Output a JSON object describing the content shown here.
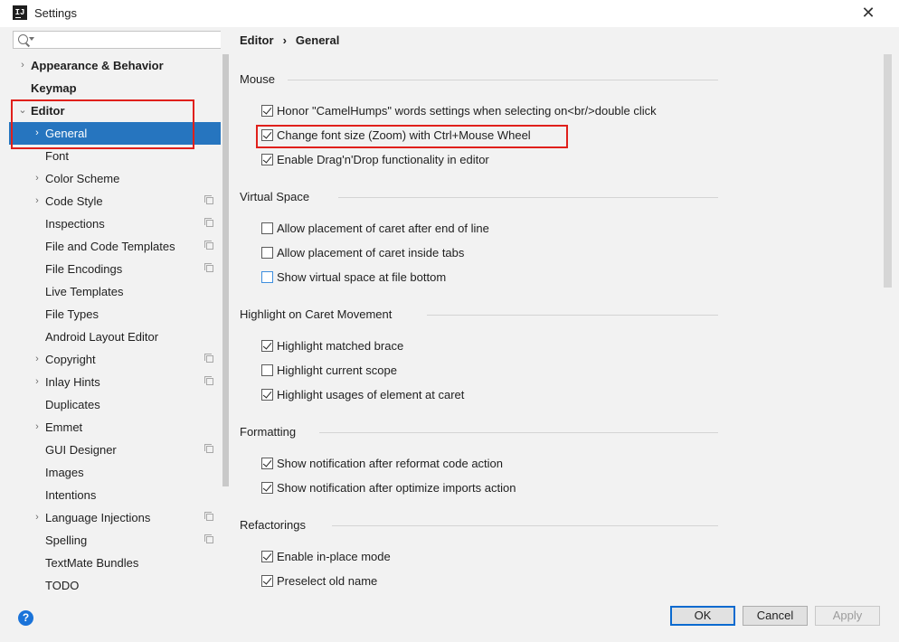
{
  "window": {
    "title": "Settings",
    "close_label": "✕"
  },
  "search": {
    "placeholder": ""
  },
  "sidebar": {
    "items": [
      {
        "label": "Appearance & Behavior",
        "bold": true,
        "chevron": "›",
        "indent": 0
      },
      {
        "label": "Keymap",
        "bold": true,
        "chevron": "",
        "indent": 0
      },
      {
        "label": "Editor",
        "bold": true,
        "chevron": "⌄",
        "indent": 0
      },
      {
        "label": "General",
        "bold": false,
        "chevron": "›",
        "indent": 1,
        "selected": true
      },
      {
        "label": "Font",
        "bold": false,
        "chevron": "",
        "indent": 1
      },
      {
        "label": "Color Scheme",
        "bold": false,
        "chevron": "›",
        "indent": 1
      },
      {
        "label": "Code Style",
        "bold": false,
        "chevron": "›",
        "indent": 1,
        "project_icon": true
      },
      {
        "label": "Inspections",
        "bold": false,
        "chevron": "",
        "indent": 1,
        "project_icon": true
      },
      {
        "label": "File and Code Templates",
        "bold": false,
        "chevron": "",
        "indent": 1,
        "project_icon": true
      },
      {
        "label": "File Encodings",
        "bold": false,
        "chevron": "",
        "indent": 1,
        "project_icon": true
      },
      {
        "label": "Live Templates",
        "bold": false,
        "chevron": "",
        "indent": 1
      },
      {
        "label": "File Types",
        "bold": false,
        "chevron": "",
        "indent": 1
      },
      {
        "label": "Android Layout Editor",
        "bold": false,
        "chevron": "",
        "indent": 1
      },
      {
        "label": "Copyright",
        "bold": false,
        "chevron": "›",
        "indent": 1,
        "project_icon": true
      },
      {
        "label": "Inlay Hints",
        "bold": false,
        "chevron": "›",
        "indent": 1,
        "project_icon": true
      },
      {
        "label": "Duplicates",
        "bold": false,
        "chevron": "",
        "indent": 1
      },
      {
        "label": "Emmet",
        "bold": false,
        "chevron": "›",
        "indent": 1
      },
      {
        "label": "GUI Designer",
        "bold": false,
        "chevron": "",
        "indent": 1,
        "project_icon": true
      },
      {
        "label": "Images",
        "bold": false,
        "chevron": "",
        "indent": 1
      },
      {
        "label": "Intentions",
        "bold": false,
        "chevron": "",
        "indent": 1
      },
      {
        "label": "Language Injections",
        "bold": false,
        "chevron": "›",
        "indent": 1,
        "project_icon": true
      },
      {
        "label": "Spelling",
        "bold": false,
        "chevron": "",
        "indent": 1,
        "project_icon": true
      },
      {
        "label": "TextMate Bundles",
        "bold": false,
        "chevron": "",
        "indent": 1
      },
      {
        "label": "TODO",
        "bold": false,
        "chevron": "",
        "indent": 1
      }
    ]
  },
  "breadcrumb": {
    "part1": "Editor",
    "separator": "›",
    "part2": "General"
  },
  "sections": [
    {
      "title": "Mouse",
      "options": [
        {
          "label": "Honor \"CamelHumps\" words settings when selecting on<br/>double click",
          "checked": true
        },
        {
          "label": "Change font size (Zoom) with Ctrl+Mouse Wheel",
          "checked": true,
          "highlighted": true
        },
        {
          "label": "Enable Drag'n'Drop functionality in editor",
          "checked": true
        }
      ]
    },
    {
      "title": "Virtual Space",
      "options": [
        {
          "label": "Allow placement of caret after end of line",
          "checked": false
        },
        {
          "label": "Allow placement of caret inside tabs",
          "checked": false
        },
        {
          "label": "Show virtual space at file bottom",
          "checked": false,
          "focused": true
        }
      ]
    },
    {
      "title": "Highlight on Caret Movement",
      "options": [
        {
          "label": "Highlight matched brace",
          "checked": true
        },
        {
          "label": "Highlight current scope",
          "checked": false
        },
        {
          "label": "Highlight usages of element at caret",
          "checked": true
        }
      ]
    },
    {
      "title": "Formatting",
      "options": [
        {
          "label": "Show notification after reformat code action",
          "checked": true
        },
        {
          "label": "Show notification after optimize imports action",
          "checked": true
        }
      ]
    },
    {
      "title": "Refactorings",
      "options": [
        {
          "label": "Enable in-place mode",
          "checked": true
        },
        {
          "label": "Preselect old name",
          "checked": true
        }
      ]
    }
  ],
  "footer": {
    "help": "?",
    "ok": "OK",
    "cancel": "Cancel",
    "apply": "Apply"
  },
  "colors": {
    "selection": "#2675bf",
    "highlight_box": "#e0201b",
    "help": "#1a73d9"
  }
}
